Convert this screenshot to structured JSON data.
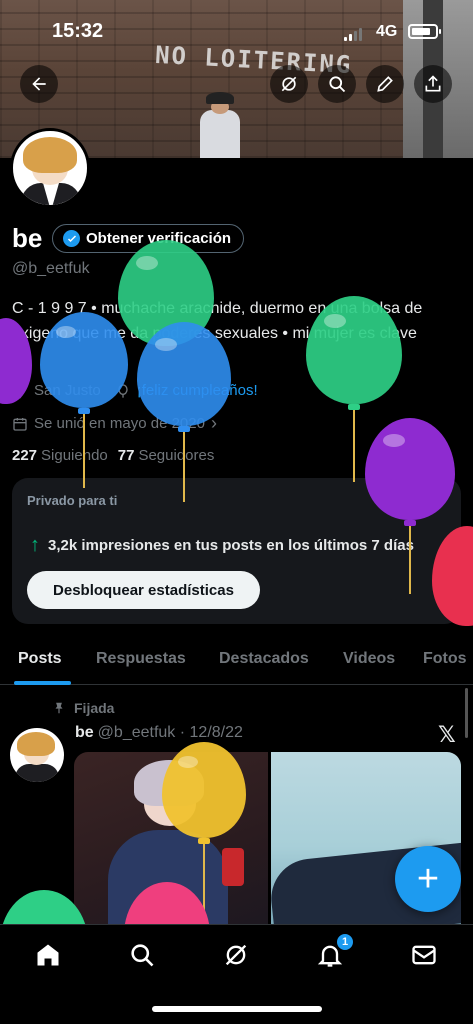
{
  "status_bar": {
    "time": "15:32",
    "network": "4G"
  },
  "banner": {
    "sign_text": "NO LOITERING"
  },
  "header_buttons": [
    "back",
    "grok",
    "search",
    "edit",
    "share"
  ],
  "profile": {
    "name": "be",
    "verify_label": "Obtener verificación",
    "handle": "@b_eetfuk",
    "bio": "C - 1 9 9 7 • muchache aracnide, duermo en una bolsa de oxigeno que me da poderes sexuales • mi mujer es clave",
    "location": "San Justo",
    "link": "¡feliz cumpleaños!",
    "joined": "Se unió en mayo de 2020",
    "following_count": "227",
    "following_label": "Siguiendo",
    "followers_count": "77",
    "followers_label": "Seguidores"
  },
  "private_card": {
    "title": "Privado para ti",
    "stat": "3,2k impresiones en tus posts en los últimos 7 días",
    "button": "Desbloquear estadísticas"
  },
  "tabs": [
    "Posts",
    "Respuestas",
    "Destacados",
    "Videos",
    "Fotos"
  ],
  "pinned_post": {
    "pinned_label": "Fijada",
    "author": "be",
    "handle_date": "@b_eetfuk · 12/8/22"
  },
  "nav": {
    "notifications_badge": "1"
  },
  "colors": {
    "accent": "#1d9bf0",
    "green": "#00ba7c",
    "background": "#000000"
  }
}
